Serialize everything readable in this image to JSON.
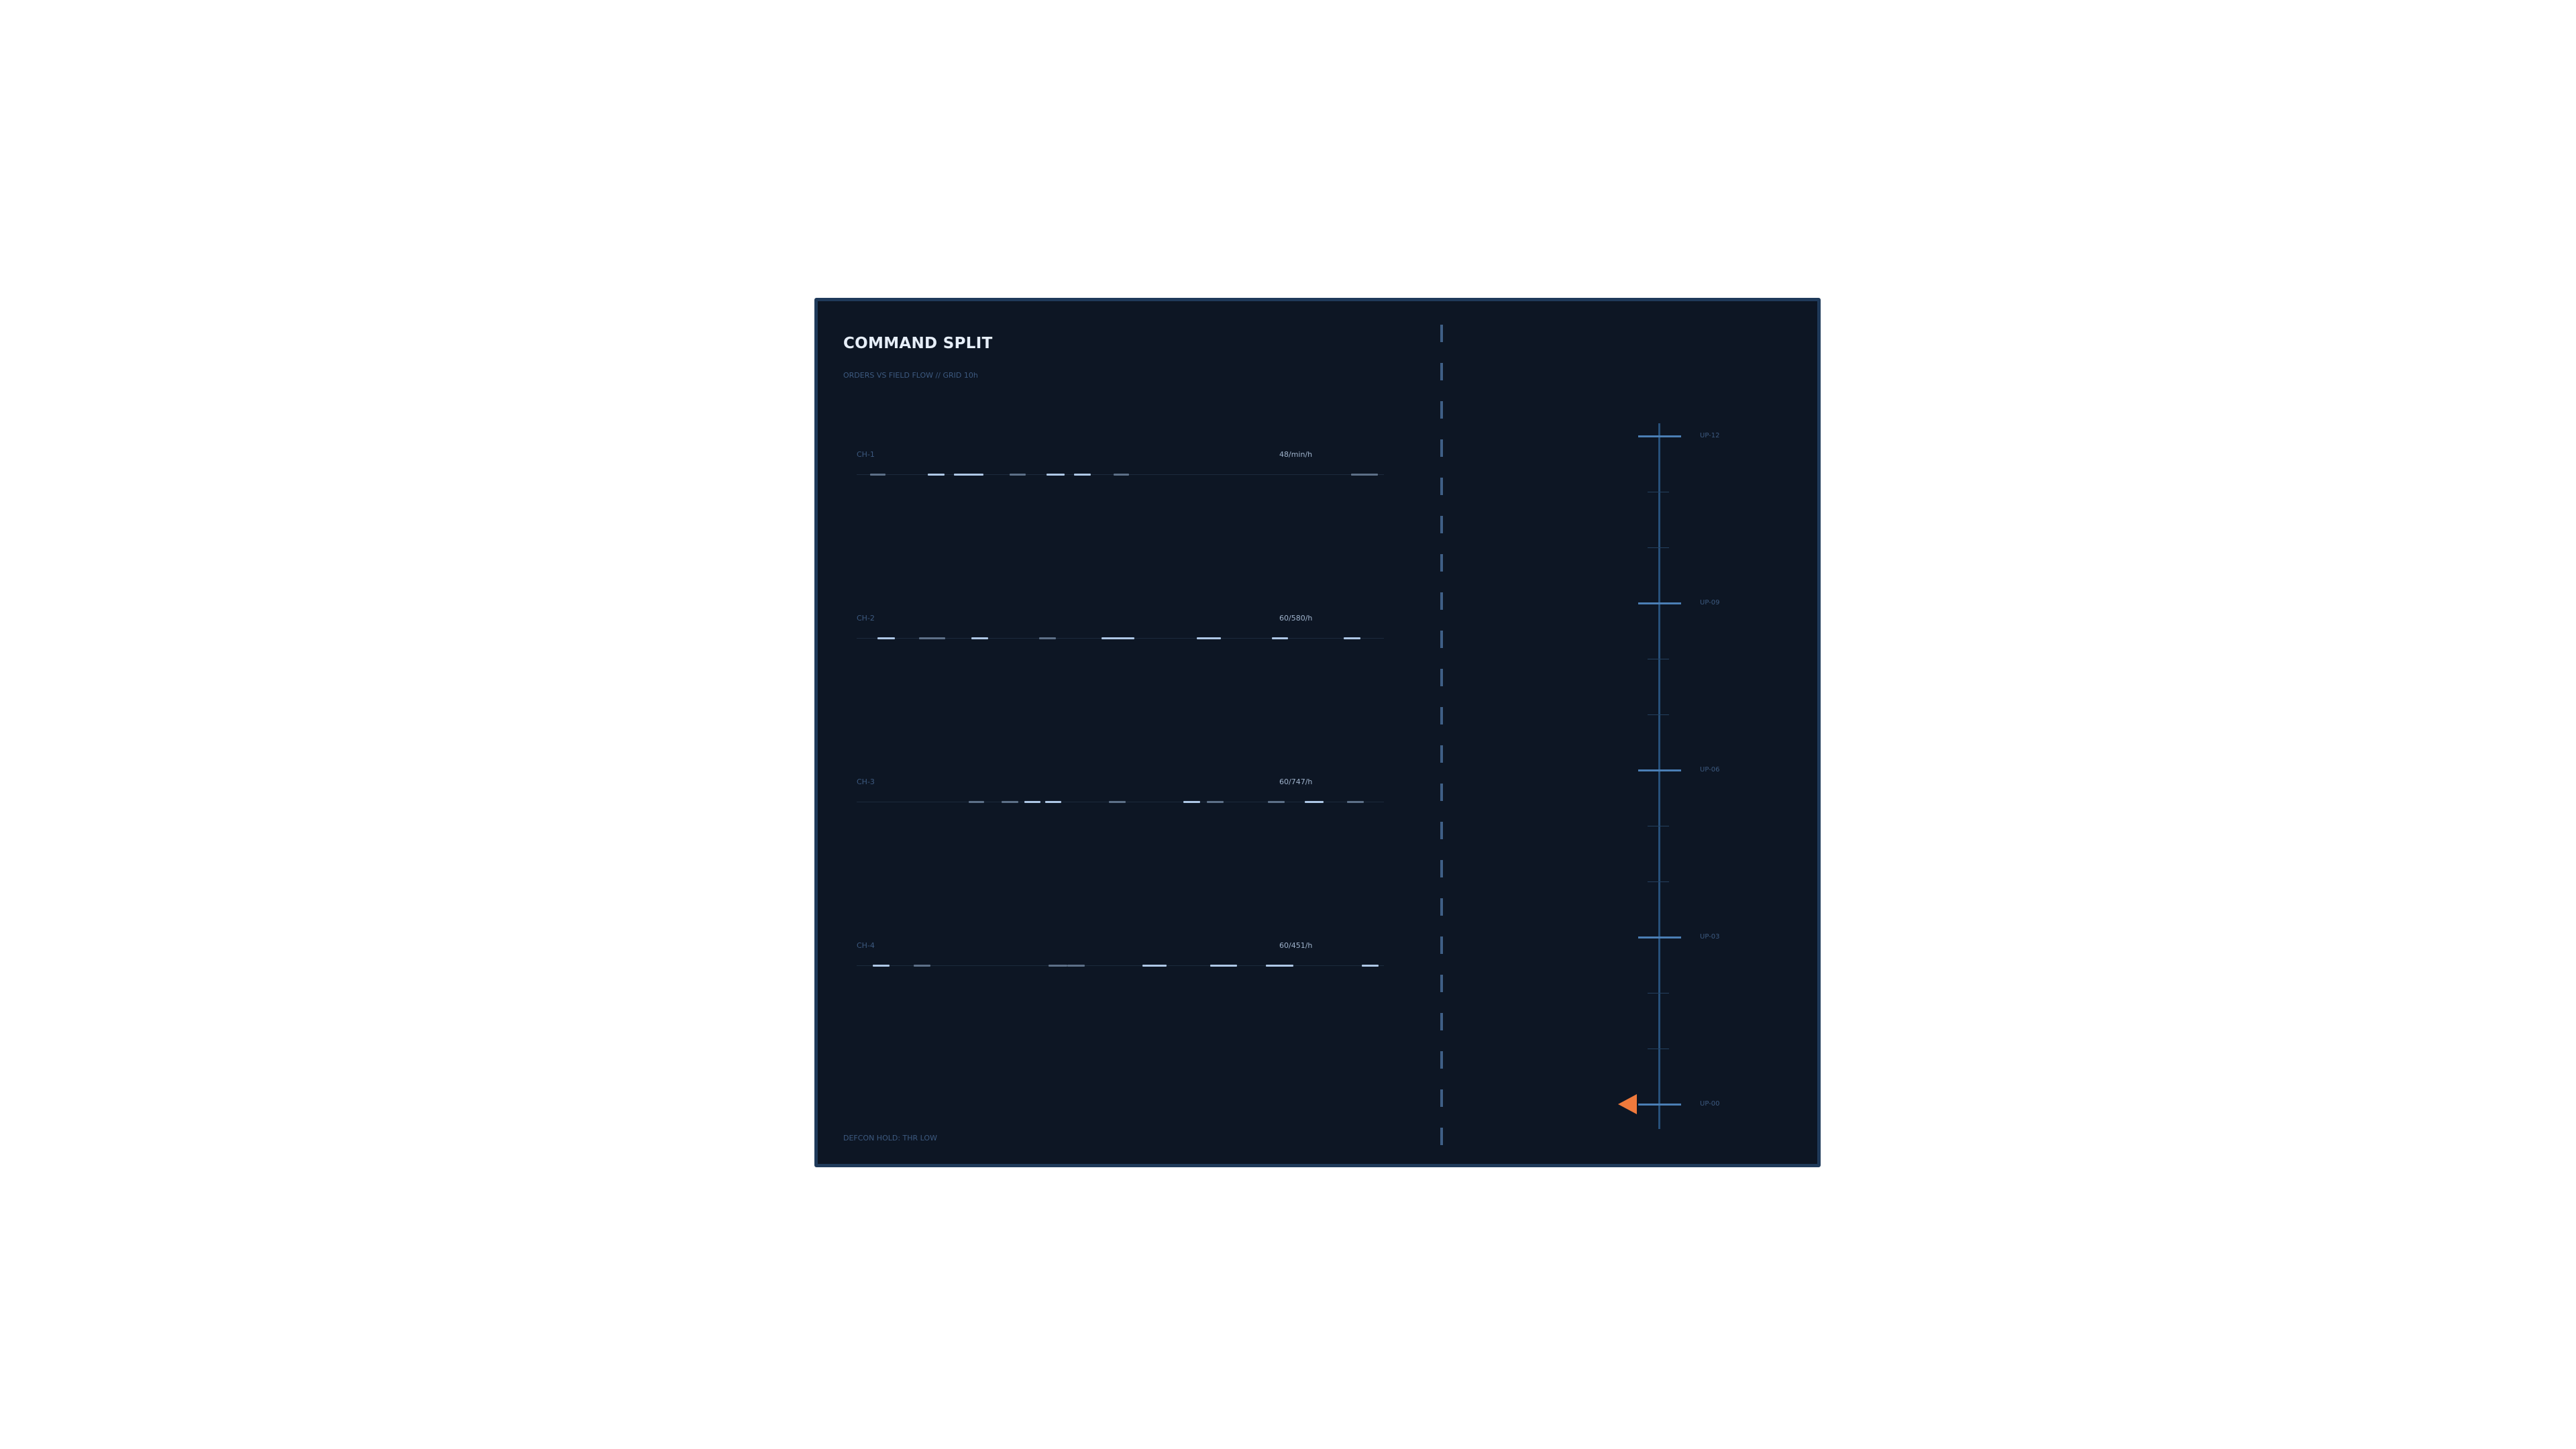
{
  "panel": {
    "title": "COMMAND SPLIT",
    "subtitle": "ORDERS VS FIELD FLOW // GRID 10h",
    "footer": "DEFCON HOLD: THR LOW"
  },
  "channels": [
    {
      "label": "CH-1",
      "rate": "48/min/h",
      "segments": [
        {
          "x": 0.025,
          "w": 0.03,
          "tone": "dim"
        },
        {
          "x": 0.135,
          "w": 0.032,
          "tone": "bright"
        },
        {
          "x": 0.185,
          "w": 0.055,
          "tone": "bright"
        },
        {
          "x": 0.29,
          "w": 0.03,
          "tone": "dim"
        },
        {
          "x": 0.36,
          "w": 0.034,
          "tone": "bright"
        },
        {
          "x": 0.412,
          "w": 0.032,
          "tone": "bright"
        },
        {
          "x": 0.487,
          "w": 0.03,
          "tone": "dim"
        },
        {
          "x": 0.938,
          "w": 0.05,
          "tone": "dim"
        }
      ]
    },
    {
      "label": "CH-2",
      "rate": "60/580/h",
      "segments": [
        {
          "x": 0.04,
          "w": 0.032,
          "tone": "bright"
        },
        {
          "x": 0.118,
          "w": 0.05,
          "tone": "dim"
        },
        {
          "x": 0.218,
          "w": 0.032,
          "tone": "bright"
        },
        {
          "x": 0.346,
          "w": 0.032,
          "tone": "dim"
        },
        {
          "x": 0.465,
          "w": 0.062,
          "tone": "bright"
        },
        {
          "x": 0.645,
          "w": 0.046,
          "tone": "bright"
        },
        {
          "x": 0.788,
          "w": 0.03,
          "tone": "bright"
        },
        {
          "x": 0.924,
          "w": 0.032,
          "tone": "bright"
        }
      ]
    },
    {
      "label": "CH-3",
      "rate": "60/747/h",
      "segments": [
        {
          "x": 0.212,
          "w": 0.03,
          "tone": "dim"
        },
        {
          "x": 0.275,
          "w": 0.032,
          "tone": "dim"
        },
        {
          "x": 0.318,
          "w": 0.03,
          "tone": "bright"
        },
        {
          "x": 0.358,
          "w": 0.03,
          "tone": "bright"
        },
        {
          "x": 0.478,
          "w": 0.032,
          "tone": "dim"
        },
        {
          "x": 0.62,
          "w": 0.032,
          "tone": "bright"
        },
        {
          "x": 0.664,
          "w": 0.032,
          "tone": "dim"
        },
        {
          "x": 0.78,
          "w": 0.032,
          "tone": "dim"
        },
        {
          "x": 0.85,
          "w": 0.036,
          "tone": "bright"
        },
        {
          "x": 0.93,
          "w": 0.032,
          "tone": "dim"
        }
      ]
    },
    {
      "label": "CH-4",
      "rate": "60/451/h",
      "segments": [
        {
          "x": 0.03,
          "w": 0.032,
          "tone": "bright"
        },
        {
          "x": 0.108,
          "w": 0.032,
          "tone": "dim"
        },
        {
          "x": 0.364,
          "w": 0.036,
          "tone": "dim"
        },
        {
          "x": 0.4,
          "w": 0.032,
          "tone": "dim"
        },
        {
          "x": 0.542,
          "w": 0.046,
          "tone": "bright"
        },
        {
          "x": 0.67,
          "w": 0.052,
          "tone": "bright"
        },
        {
          "x": 0.776,
          "w": 0.052,
          "tone": "bright"
        },
        {
          "x": 0.958,
          "w": 0.032,
          "tone": "bright"
        }
      ]
    }
  ],
  "scale": {
    "ticks": [
      "UP-12",
      "UP-09",
      "UP-06",
      "UP-03",
      "UP-00"
    ],
    "marker_value": 0
  },
  "colors": {
    "background": "#0d1624",
    "accent": "#f07a3c",
    "bright_segment": "#aec7e6",
    "dim_segment": "#5d7088"
  }
}
